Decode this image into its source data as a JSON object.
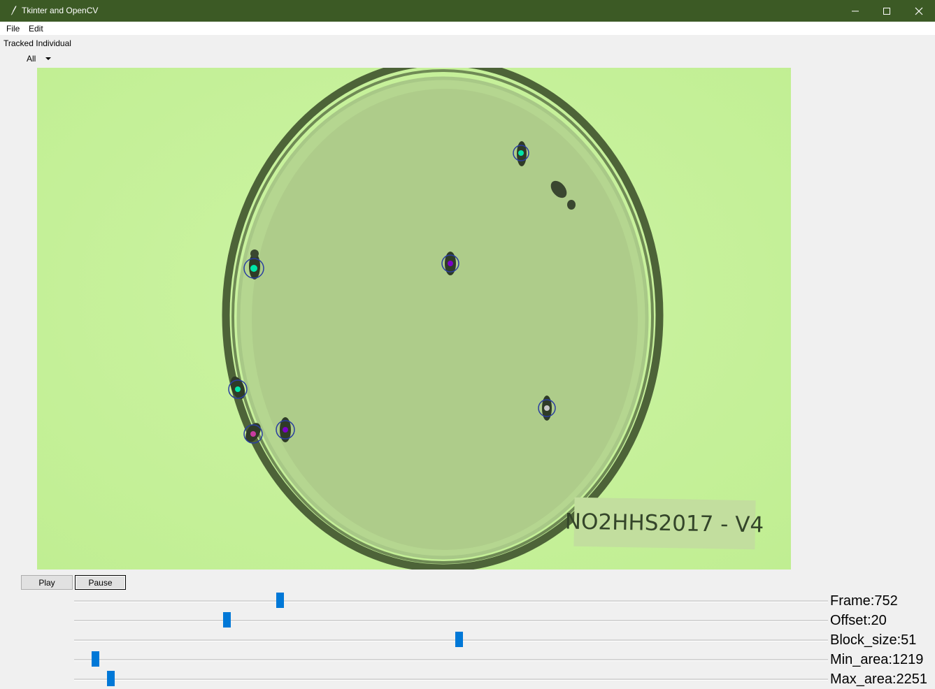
{
  "window": {
    "title": "Tkinter and OpenCV",
    "titlebar_color": "#3c5a25",
    "controls": [
      "minimize-icon",
      "maximize-icon",
      "close-icon"
    ]
  },
  "menubar": {
    "items": [
      "File",
      "Edit"
    ]
  },
  "tracking": {
    "label": "Tracked Individual",
    "selected": "All"
  },
  "video": {
    "plate_label": "NO2HHS2017 - V4",
    "background_color": "#c6f29a",
    "tracked_marker_colors": [
      "#00e6a8",
      "#7a00c8",
      "#c83ca0",
      "#c8c8c8",
      "#2a3ea0"
    ]
  },
  "buttons": {
    "play": "Play",
    "pause": "Pause"
  },
  "sliders": [
    {
      "label": "Frame:752",
      "level_pct": 27.3
    },
    {
      "label": "Offset:20",
      "level_pct": 20.2
    },
    {
      "label": "Block_size:51",
      "level_pct": 51
    },
    {
      "label": "Min_area:1219",
      "level_pct": 2.8
    },
    {
      "label": "Max_area:2251",
      "level_pct": 4.8
    }
  ],
  "accent_color": "#0078d7"
}
